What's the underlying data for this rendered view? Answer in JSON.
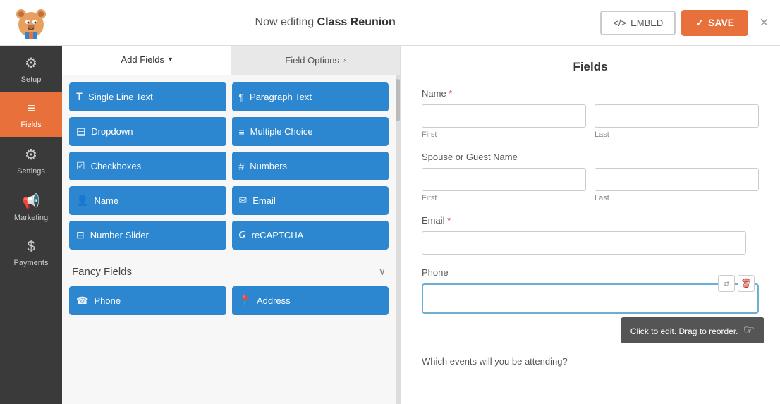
{
  "header": {
    "title_prefix": "Now editing ",
    "title_name": "Class Reunion",
    "embed_label": "EMBED",
    "save_label": "SAVE",
    "close_symbol": "×"
  },
  "sidebar": {
    "items": [
      {
        "id": "setup",
        "label": "Setup",
        "icon": "⚙️"
      },
      {
        "id": "fields",
        "label": "Fields",
        "icon": "≡",
        "active": true
      },
      {
        "id": "settings",
        "label": "Settings",
        "icon": "⚙️"
      },
      {
        "id": "marketing",
        "label": "Marketing",
        "icon": "📢"
      },
      {
        "id": "payments",
        "label": "Payments",
        "icon": "💲"
      }
    ]
  },
  "tabs": {
    "add_fields_label": "Add Fields",
    "field_options_label": "Field Options"
  },
  "field_buttons": [
    {
      "id": "single-line-text",
      "label": "Single Line Text",
      "icon": "T"
    },
    {
      "id": "paragraph-text",
      "label": "Paragraph Text",
      "icon": "¶"
    },
    {
      "id": "dropdown",
      "label": "Dropdown",
      "icon": "▼"
    },
    {
      "id": "multiple-choice",
      "label": "Multiple Choice",
      "icon": "≡"
    },
    {
      "id": "checkboxes",
      "label": "Checkboxes",
      "icon": "☑"
    },
    {
      "id": "numbers",
      "label": "Numbers",
      "icon": "#"
    },
    {
      "id": "name",
      "label": "Name",
      "icon": "👤"
    },
    {
      "id": "email",
      "label": "Email",
      "icon": "✉"
    },
    {
      "id": "number-slider",
      "label": "Number Slider",
      "icon": "⊟"
    },
    {
      "id": "recaptcha",
      "label": "reCAPTCHA",
      "icon": "G"
    }
  ],
  "fancy_fields": {
    "label": "Fancy Fields",
    "items": [
      {
        "id": "phone",
        "label": "Phone",
        "icon": "📞"
      },
      {
        "id": "address",
        "label": "Address",
        "icon": "📍"
      }
    ]
  },
  "form": {
    "title": "Fields",
    "fields": [
      {
        "id": "name",
        "label": "Name",
        "required": true,
        "type": "name-row",
        "first_label": "First",
        "last_label": "Last"
      },
      {
        "id": "spouse-guest-name",
        "label": "Spouse or Guest Name",
        "required": false,
        "type": "name-row",
        "first_label": "First",
        "last_label": "Last"
      },
      {
        "id": "email",
        "label": "Email",
        "required": true,
        "type": "single"
      },
      {
        "id": "phone",
        "label": "Phone",
        "required": false,
        "type": "phone",
        "active": true
      },
      {
        "id": "which-events",
        "label": "Which events will you be attending?",
        "required": false,
        "type": "partial"
      }
    ]
  },
  "tooltip": {
    "text": "Click to edit. Drag to reorder."
  },
  "icons": {
    "copy": "⧉",
    "delete": "🗑",
    "embed_code": "</>",
    "check": "✓",
    "chevron_right": "›",
    "chevron_down": "∨"
  }
}
